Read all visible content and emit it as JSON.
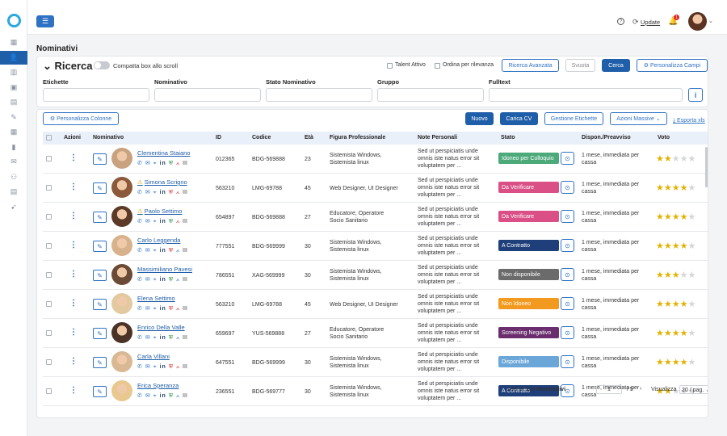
{
  "topbar": {
    "update_label": "Update",
    "notification_count": "1"
  },
  "nav": {
    "icons": [
      "dashboard-icon",
      "user-icon",
      "building-icon",
      "chat-icon",
      "document-icon",
      "edit-icon",
      "calendar-icon",
      "chart-icon",
      "mail-icon",
      "team-icon",
      "printer-icon",
      "rocket-icon"
    ]
  },
  "page": {
    "title": "Nominativi"
  },
  "search": {
    "title": "Ricerca",
    "compact_label": "Compatta box allo scroll",
    "talent_label": "Talent Attivo",
    "relevance_label": "Ordina per rilevanza",
    "advanced_label": "Ricerca Avanzata",
    "clear_label": "Svuota",
    "search_label": "Cerca",
    "customize_fields_label": "Personalizza Campi",
    "fields": [
      "Etichette",
      "Nominativo",
      "Stato Nominativo",
      "Gruppo",
      "Fulltext"
    ],
    "info_label": "i"
  },
  "toolbar": {
    "customize_columns_label": "Personalizza Colonne",
    "new_label": "Nuovo",
    "upload_cv_label": "Carica CV",
    "labels_label": "Gestione Etichette",
    "mass_actions_label": "Azioni Massive",
    "export_label": "Esporta xls"
  },
  "table": {
    "headers": [
      "Azioni",
      "Nominativo",
      "ID",
      "Codice",
      "Età",
      "Figura Professionale",
      "Note Personali",
      "Stato",
      "Dispon./Preavviso",
      "Voto"
    ],
    "rows": [
      {
        "name": "Clementina Staiano",
        "warn": false,
        "id": "012365",
        "code": "BDG-569888",
        "age": "23",
        "role1": "Sistemista Windows,",
        "role2": "Sistemista linux",
        "status": "Idoneo per Colloquio",
        "status_color": "#4caa7a",
        "stars": 2
      },
      {
        "name": "Simona Scrigno",
        "warn": true,
        "id": "563210",
        "code": "LMG-69788",
        "age": "45",
        "role1": "Web Designer, UI Designer",
        "role2": "",
        "status": "Da Verificare",
        "status_color": "#d94f86",
        "stars": 4
      },
      {
        "name": "Paolo Settimo",
        "warn": true,
        "id": "654897",
        "code": "BDG-569888",
        "age": "27",
        "role1": "Educatore, Operatore",
        "role2": "Socio Sanitario",
        "status": "Da Verificare",
        "status_color": "#d94f86",
        "stars": 4
      },
      {
        "name": "Carlo Leggenda",
        "warn": false,
        "id": "777551",
        "code": "BDG-569999",
        "age": "30",
        "role1": "Sistemista Windows,",
        "role2": "Sistemista linux",
        "status": "A Contratto",
        "status_color": "#1f3f7a",
        "stars": 4
      },
      {
        "name": "Massimiliano Pavesi",
        "warn": false,
        "id": "786551",
        "code": "XAG-569999",
        "age": "30",
        "role1": "Sistemista Windows,",
        "role2": "Sistemista linux",
        "status": "Non disponibile",
        "status_color": "#6b6b6b",
        "stars": 3
      },
      {
        "name": "Elena Settimo",
        "warn": false,
        "id": "563210",
        "code": "LMG-69788",
        "age": "45",
        "role1": "Web Designer, UI Designer",
        "role2": "",
        "status": "Non Idoneo",
        "status_color": "#f29a1f",
        "stars": 4
      },
      {
        "name": "Enrico Della Valle",
        "warn": false,
        "id": "659697",
        "code": "YUS-569888",
        "age": "27",
        "role1": "Educatore, Operatore",
        "role2": "Socio Sanitario",
        "status": "Screening Negativo",
        "status_color": "#6a2d6e",
        "stars": 4
      },
      {
        "name": "Carla Villani",
        "warn": false,
        "id": "647551",
        "code": "BDG-569999",
        "age": "30",
        "role1": "Sistemista Windows,",
        "role2": "Sistemista linux",
        "status": "Disponibile",
        "status_color": "#6ba6d9",
        "stars": 4
      },
      {
        "name": "Erica Speranza",
        "warn": false,
        "id": "236551",
        "code": "BDG-569777",
        "age": "30",
        "role1": "Sistemista Windows,",
        "role2": "Sistemista linux",
        "status": "A Contratto",
        "status_color": "#1f3f7a",
        "stars": 2
      }
    ],
    "note_lines": [
      "Sed ut perspiciatis unde",
      "omnis iste natus error sit",
      "voluptatem per ..."
    ],
    "availability_lines": [
      "1 mese, immediata per",
      "cassa"
    ]
  },
  "pagination": {
    "range": "1-20 di",
    "total": "110 Nominativi",
    "page": "1",
    "of_pages": "/ 5",
    "show_label": "Visualizza",
    "per_page": "20 / pag."
  }
}
